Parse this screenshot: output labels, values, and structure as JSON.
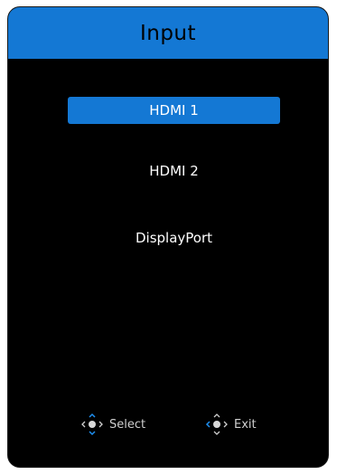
{
  "header": {
    "title": "Input"
  },
  "menu": {
    "items": [
      {
        "label": "HDMI 1",
        "selected": true
      },
      {
        "label": "HDMI 2",
        "selected": false
      },
      {
        "label": "DisplayPort",
        "selected": false
      }
    ]
  },
  "footer": {
    "select_label": "Select",
    "exit_label": "Exit",
    "select_icon": "joystick-updown-icon",
    "exit_icon": "joystick-icon"
  },
  "colors": {
    "accent": "#1478d4",
    "background": "#000000",
    "text": "#ffffff"
  }
}
